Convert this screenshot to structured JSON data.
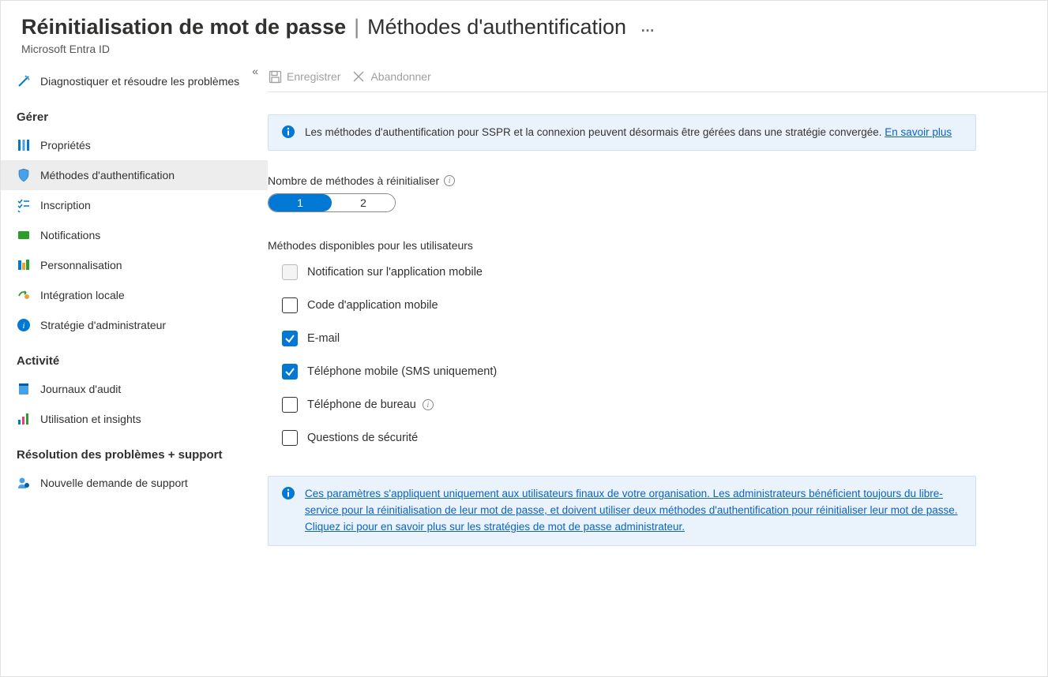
{
  "header": {
    "title": "Réinitialisation de mot de passe",
    "separator": "|",
    "subtitle": "Méthodes d'authentification",
    "more": "…",
    "product": "Microsoft Entra ID"
  },
  "toolbar": {
    "save": "Enregistrer",
    "discard": "Abandonner"
  },
  "sidebar": {
    "collapse": "«",
    "diagnose": "Diagnostiquer et résoudre les problèmes",
    "section_manage": "Gérer",
    "items": [
      {
        "label": "Propriétés"
      },
      {
        "label": "Méthodes d'authentification"
      },
      {
        "label": "Inscription"
      },
      {
        "label": "Notifications"
      },
      {
        "label": "Personnalisation"
      },
      {
        "label": "Intégration locale"
      },
      {
        "label": "Stratégie d'administrateur"
      }
    ],
    "section_activity": "Activité",
    "activity": [
      {
        "label": "Journaux d'audit"
      },
      {
        "label": "Utilisation et insights"
      }
    ],
    "section_support": "Résolution des problèmes + support",
    "support": [
      {
        "label": "Nouvelle demande de support"
      }
    ]
  },
  "info1": {
    "text": "Les méthodes d'authentification pour SSPR et la connexion peuvent désormais être gérées dans une stratégie convergée. ",
    "link": "En savoir plus"
  },
  "reset_count": {
    "label": "Nombre de méthodes à réinitialiser",
    "options": [
      "1",
      "2"
    ],
    "selected": "1"
  },
  "methods": {
    "heading": "Méthodes disponibles pour les utilisateurs",
    "list": [
      {
        "label": "Notification sur l'application mobile",
        "checked": false,
        "disabled": true
      },
      {
        "label": "Code d'application mobile",
        "checked": false,
        "disabled": false
      },
      {
        "label": "E-mail",
        "checked": true,
        "disabled": false
      },
      {
        "label": "Téléphone mobile (SMS uniquement)",
        "checked": true,
        "disabled": false
      },
      {
        "label": "Téléphone de bureau",
        "checked": false,
        "disabled": false,
        "help": true
      },
      {
        "label": "Questions de sécurité",
        "checked": false,
        "disabled": false
      }
    ]
  },
  "info2": {
    "text": "Ces paramètres s'appliquent uniquement aux utilisateurs finaux de votre organisation. Les administrateurs bénéficient toujours du libre-service pour la réinitialisation de leur mot de passe, et doivent utiliser deux méthodes d'authentification pour réinitialiser leur mot de passe. Cliquez ici pour en savoir plus sur les stratégies de mot de passe administrateur."
  }
}
